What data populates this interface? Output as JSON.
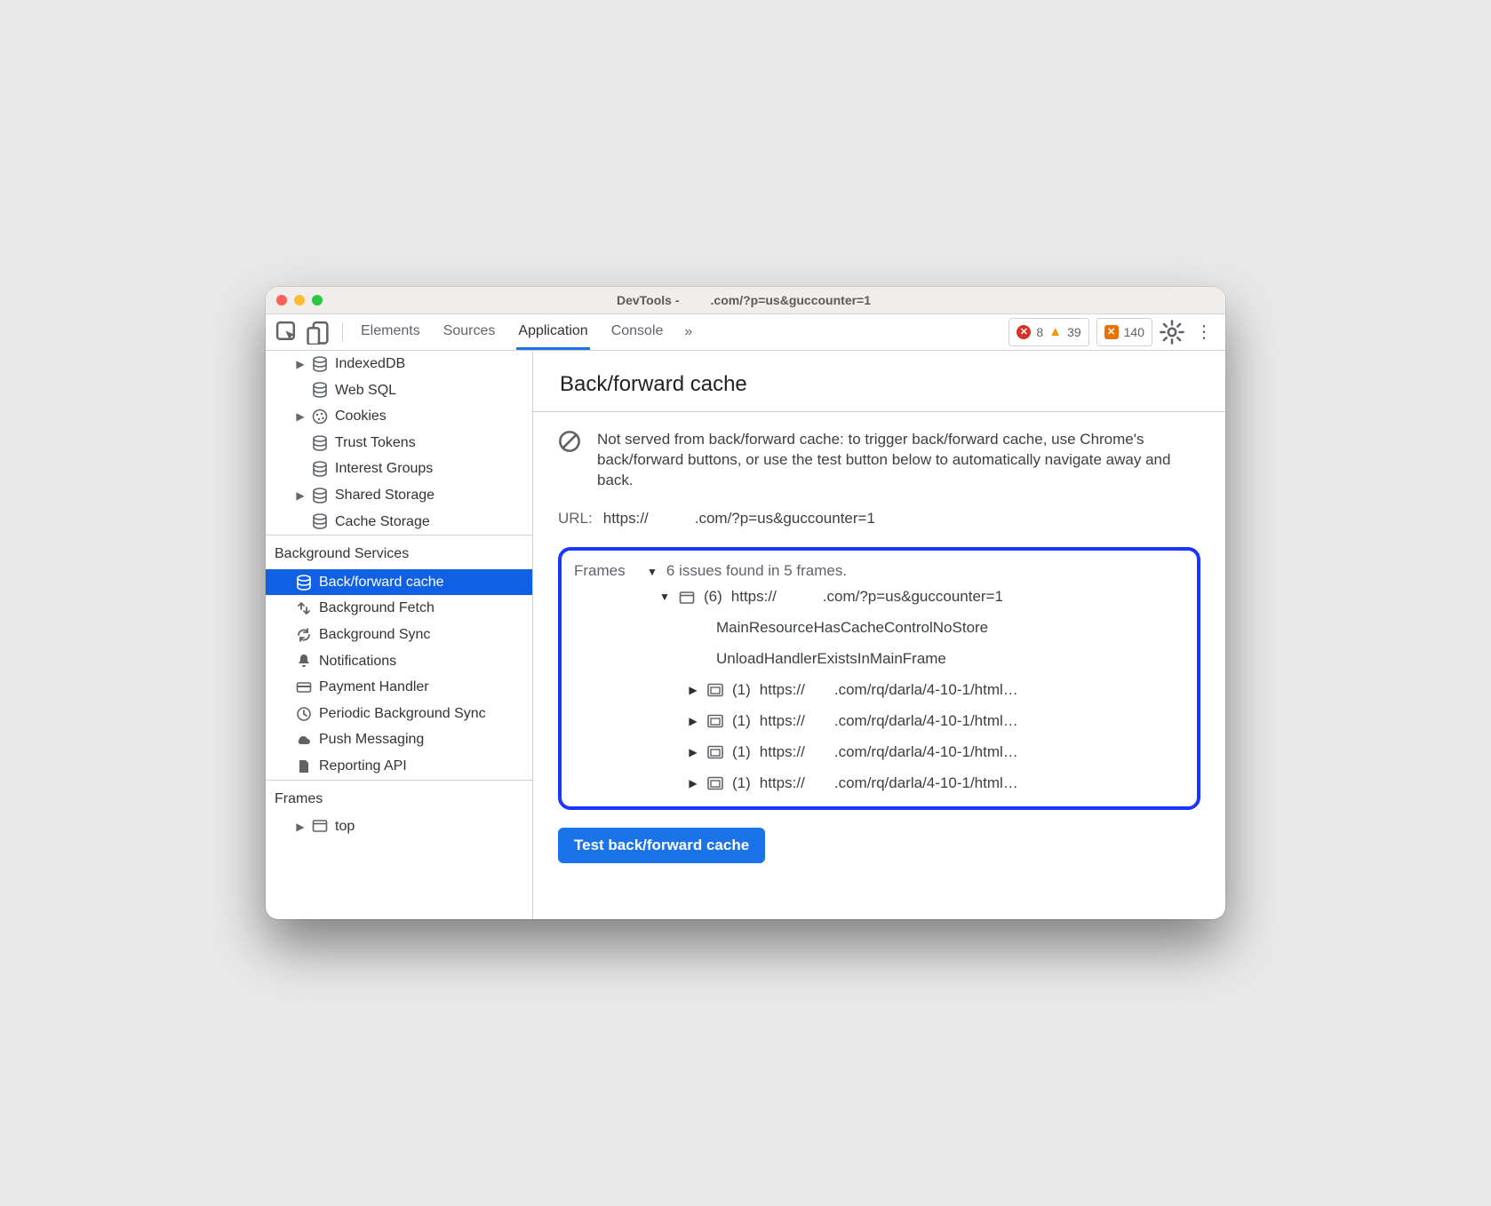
{
  "window": {
    "title_prefix": "DevTools -",
    "title_suffix": ".com/?p=us&guccounter=1"
  },
  "toolbar": {
    "tabs": [
      "Elements",
      "Sources",
      "Application",
      "Console"
    ],
    "active_tab_index": 2,
    "errors": "8",
    "warnings": "39",
    "issues": "140"
  },
  "sidebar": {
    "storage_items": [
      {
        "label": "IndexedDB",
        "icon": "db",
        "expandable": true
      },
      {
        "label": "Web SQL",
        "icon": "db",
        "expandable": false
      },
      {
        "label": "Cookies",
        "icon": "cookie",
        "expandable": true
      },
      {
        "label": "Trust Tokens",
        "icon": "db",
        "expandable": false
      },
      {
        "label": "Interest Groups",
        "icon": "db",
        "expandable": false
      },
      {
        "label": "Shared Storage",
        "icon": "db",
        "expandable": true
      },
      {
        "label": "Cache Storage",
        "icon": "db",
        "expandable": false
      }
    ],
    "bg_section": "Background Services",
    "bg_items": [
      {
        "label": "Back/forward cache",
        "icon": "db",
        "selected": true
      },
      {
        "label": "Background Fetch",
        "icon": "fetch"
      },
      {
        "label": "Background Sync",
        "icon": "sync"
      },
      {
        "label": "Notifications",
        "icon": "bell"
      },
      {
        "label": "Payment Handler",
        "icon": "card"
      },
      {
        "label": "Periodic Background Sync",
        "icon": "clock"
      },
      {
        "label": "Push Messaging",
        "icon": "cloud"
      },
      {
        "label": "Reporting API",
        "icon": "file"
      }
    ],
    "frames_section": "Frames",
    "frames_root": "top"
  },
  "main": {
    "title": "Back/forward cache",
    "warn": "Not served from back/forward cache: to trigger back/forward cache, use Chrome's back/forward buttons, or use the test button below to automatically navigate away and back.",
    "url_label": "URL:",
    "url_prefix": "https://",
    "url_suffix": ".com/?p=us&guccounter=1",
    "frames_label": "Frames",
    "frames_summary": "6 issues found in 5 frames.",
    "root_frame": {
      "count": "(6)",
      "text_prefix": "https://",
      "text_suffix": ".com/?p=us&guccounter=1"
    },
    "reasons": [
      "MainResourceHasCacheControlNoStore",
      "UnloadHandlerExistsInMainFrame"
    ],
    "child_frames": [
      {
        "count": "(1)",
        "text_prefix": "https://",
        "text_suffix": ".com/rq/darla/4-10-1/html…"
      },
      {
        "count": "(1)",
        "text_prefix": "https://",
        "text_suffix": ".com/rq/darla/4-10-1/html…"
      },
      {
        "count": "(1)",
        "text_prefix": "https://",
        "text_suffix": ".com/rq/darla/4-10-1/html…"
      },
      {
        "count": "(1)",
        "text_prefix": "https://",
        "text_suffix": ".com/rq/darla/4-10-1/html…"
      }
    ],
    "test_button": "Test back/forward cache"
  }
}
